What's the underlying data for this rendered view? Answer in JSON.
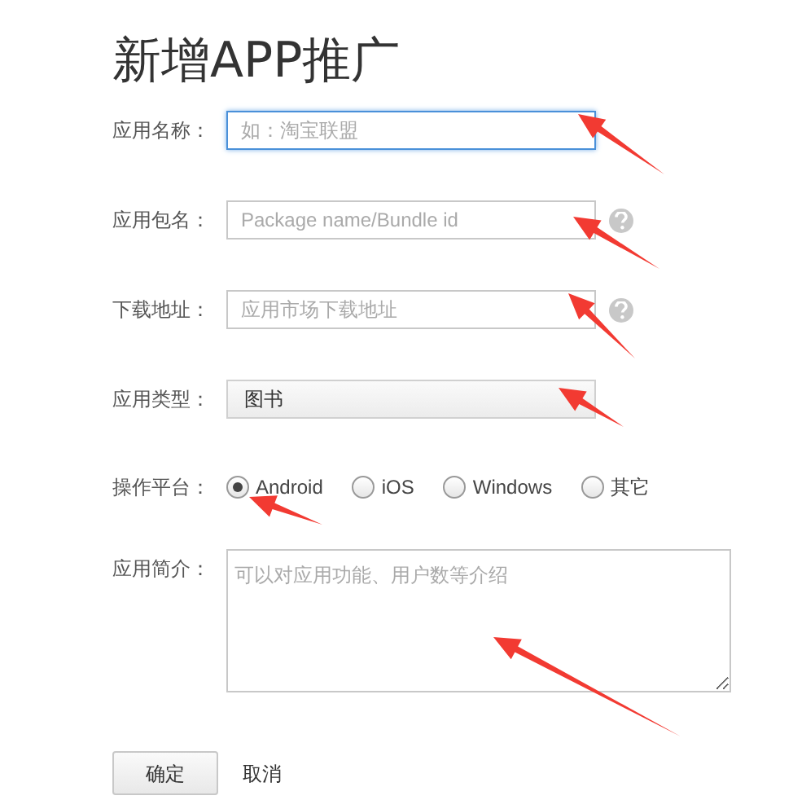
{
  "title": "新增APP推广",
  "fields": [
    {
      "kind": "text",
      "label": "应用名称：",
      "placeholder": "如：淘宝联盟",
      "focused": true,
      "help": false
    },
    {
      "kind": "text",
      "label": "应用包名：",
      "placeholder": "Package name/Bundle id",
      "focused": false,
      "help": true
    },
    {
      "kind": "text",
      "label": "下载地址：",
      "placeholder": "应用市场下载地址",
      "focused": false,
      "help": true
    },
    {
      "kind": "select",
      "label": "应用类型：",
      "value": "图书"
    },
    {
      "kind": "radio",
      "label": "操作平台：",
      "options": [
        {
          "label": "Android",
          "selected": true
        },
        {
          "label": "iOS",
          "selected": false
        },
        {
          "label": "Windows",
          "selected": false
        },
        {
          "label": "其它",
          "selected": false
        }
      ]
    },
    {
      "kind": "textarea",
      "label": "应用简介：",
      "placeholder": "可以对应用功能、用户数等介绍"
    }
  ],
  "buttons": [
    {
      "kind": "primary",
      "label": "确定"
    },
    {
      "kind": "link",
      "label": "取消"
    }
  ]
}
